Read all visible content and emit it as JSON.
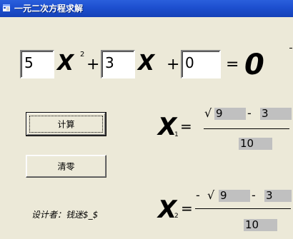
{
  "window": {
    "title": "一元二次方程求解",
    "icon": "app-icon"
  },
  "equation": {
    "coef_a": "5",
    "coef_b": "3",
    "coef_c": "0",
    "var_x1": "X",
    "exp_2": "2",
    "plus_1": "+",
    "var_x2": "X",
    "plus_2": "+",
    "equals": "=",
    "rhs": "0"
  },
  "buttons": {
    "calculate": "计算",
    "clear": "清零"
  },
  "root1": {
    "x_label": "X",
    "subscript": "1",
    "equals": "=",
    "sign": "",
    "sqrt": "√",
    "radicand": "9",
    "minus": "-",
    "b_value": "3",
    "denominator": "10"
  },
  "root2": {
    "x_label": "X",
    "subscript": "2",
    "equals": "=",
    "sign": "-",
    "sqrt": "√",
    "radicand": "9",
    "minus": "-",
    "b_value": "3",
    "denominator": "10"
  },
  "footer": {
    "designer": "设计者：钱迷$_$"
  },
  "colors": {
    "titlebar": "#1d4fcf",
    "window_bg": "#ece9d8",
    "label_bg": "#c0c0c0"
  }
}
